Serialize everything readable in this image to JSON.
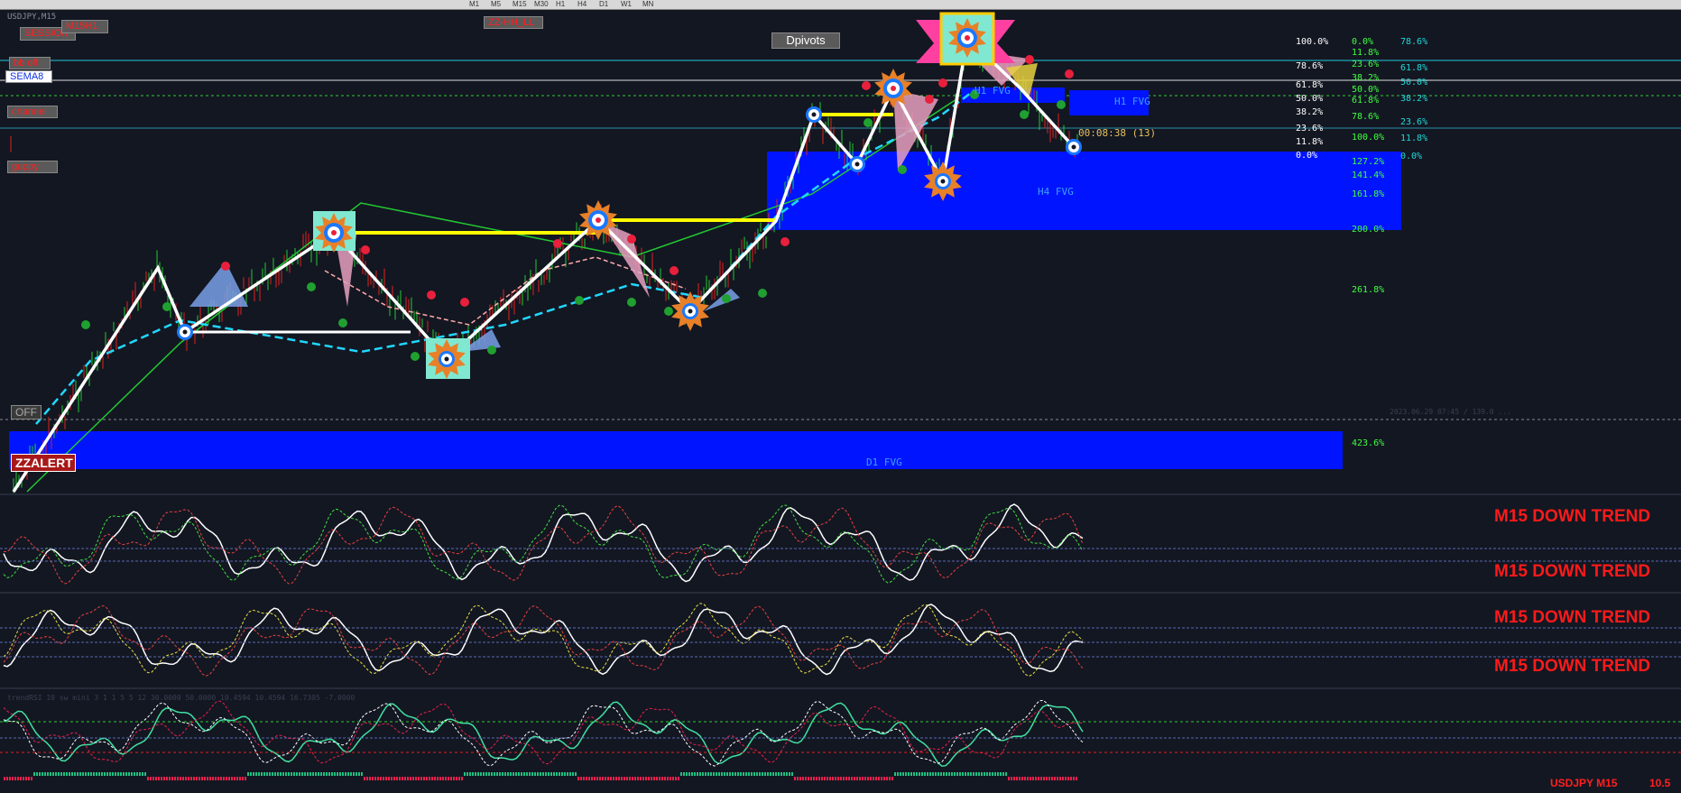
{
  "toolbar": {
    "timeframes": [
      "M1",
      "M5",
      "M15",
      "M30",
      "H1",
      "H4",
      "D1",
      "W1",
      "MN"
    ]
  },
  "symbol": {
    "label": "USDJPY,M15",
    "footer": "USDJPY M15",
    "footer_value": "10.5"
  },
  "buttons": {
    "session": "SESSION",
    "m15h1": "M15H1",
    "bb_off": "bb off",
    "sema": "SEMA8",
    "channel": "channel",
    "guppy": "guppy",
    "zz_hh_ll": "ZZ-HH_LL",
    "dpivots": "Dpivots",
    "off": "OFF",
    "zzalert": "ZZALERT"
  },
  "zones": {
    "h1_fvg_a": "H1 FVG",
    "h1_fvg_b": "H1 FVG",
    "h4_fvg": "H4 FVG",
    "d1_fvg": "D1 FVG"
  },
  "timer": "00:08:38 (13)",
  "fib_white": [
    "100.0%",
    "78.6%",
    "61.8%",
    "50.0%",
    "38.2%",
    "23.6%",
    "11.8%",
    "0.0%"
  ],
  "fib_green": [
    "0.0%",
    "11.8%",
    "23.6%",
    "38.2%",
    "50.0%",
    "61.8%",
    "78.6%",
    "100.0%",
    "127.2%",
    "141.4%",
    "161.8%",
    "200.0%",
    "261.8%",
    "423.6%"
  ],
  "fib_cyan": [
    "78.6%",
    "61.8%",
    "50.0%",
    "38.2%",
    "23.6%",
    "11.8%",
    "0.0%"
  ],
  "trend_labels": [
    "M15 DOWN TREND",
    "M15 DOWN TREND",
    "M15 DOWN TREND",
    "M15 DOWN TREND"
  ],
  "rsi_params": "trendRSI 10 sw mini 3 1 1 5 5 12 30.0000 50.0000 10.4594 10.4594 16.7305 -7.0000",
  "date_note": "2023.06.29 07:45 / 139.0 ...",
  "colors": {
    "background": "#131722",
    "bull": "#22c832",
    "bear": "#e02020",
    "zigzag": "#ffffff",
    "fvg": "#0014ff",
    "fib_green": "#40ff40",
    "fib_cyan": "#20d8d8",
    "trend": "#ff1a1a"
  }
}
